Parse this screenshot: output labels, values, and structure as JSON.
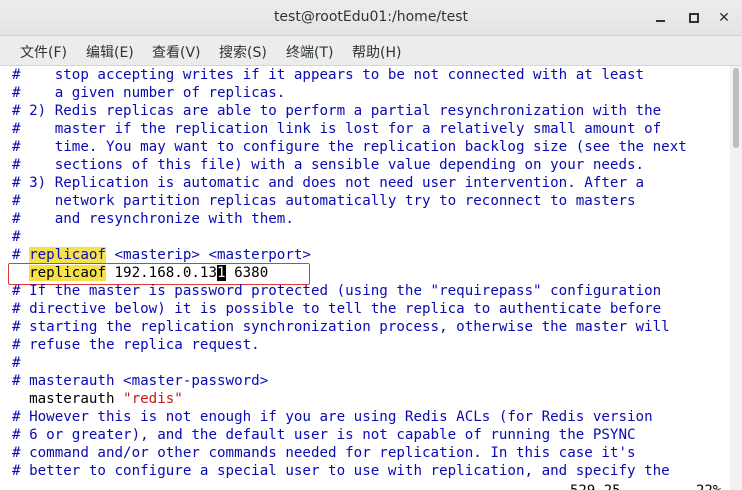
{
  "window": {
    "title": "test@rootEdu01:/home/test"
  },
  "menu": {
    "items": [
      "文件(F)",
      "编辑(E)",
      "查看(V)",
      "搜索(S)",
      "终端(T)",
      "帮助(H)"
    ]
  },
  "editor": {
    "lines": [
      "#    stop accepting writes if it appears to be not connected with at least",
      "#    a given number of replicas.",
      "# 2) Redis replicas are able to perform a partial resynchronization with the",
      "#    master if the replication link is lost for a relatively small amount of",
      "#    time. You may want to configure the replication backlog size (see the next",
      "#    sections of this file) with a sensible value depending on your needs.",
      "# 3) Replication is automatic and does not need user intervention. After a",
      "#    network partition replicas automatically try to reconnect to masters",
      "#    and resynchronize with them.",
      "#",
      "# ",
      "  ",
      "# If the master is password protected (using the \"requirepass\" configuration",
      "# directive below) it is possible to tell the replica to authenticate before",
      "# starting the replication synchronization process, otherwise the master will",
      "# refuse the replica request.",
      "#",
      "# masterauth <master-password>",
      "  masterauth ",
      "# However this is not enough if you are using Redis ACLs (for Redis version",
      "# 6 or greater), and the default user is not capable of running the PSYNC",
      "# command and/or other commands needed for replication. In this case it's",
      "# better to configure a special user to use with replication, and specify the"
    ],
    "replicaof_comment": {
      "keyword": "replicaof",
      "rest": " <masterip> <masterport>"
    },
    "replicaof_active": {
      "keyword": "replicaof",
      "before_cursor": " 192.168.0.13",
      "cursor_char": "1",
      "after_cursor": " 6380"
    },
    "masterauth_value": "\"redis\""
  },
  "status": {
    "position": "529,25",
    "percent": "22%"
  }
}
